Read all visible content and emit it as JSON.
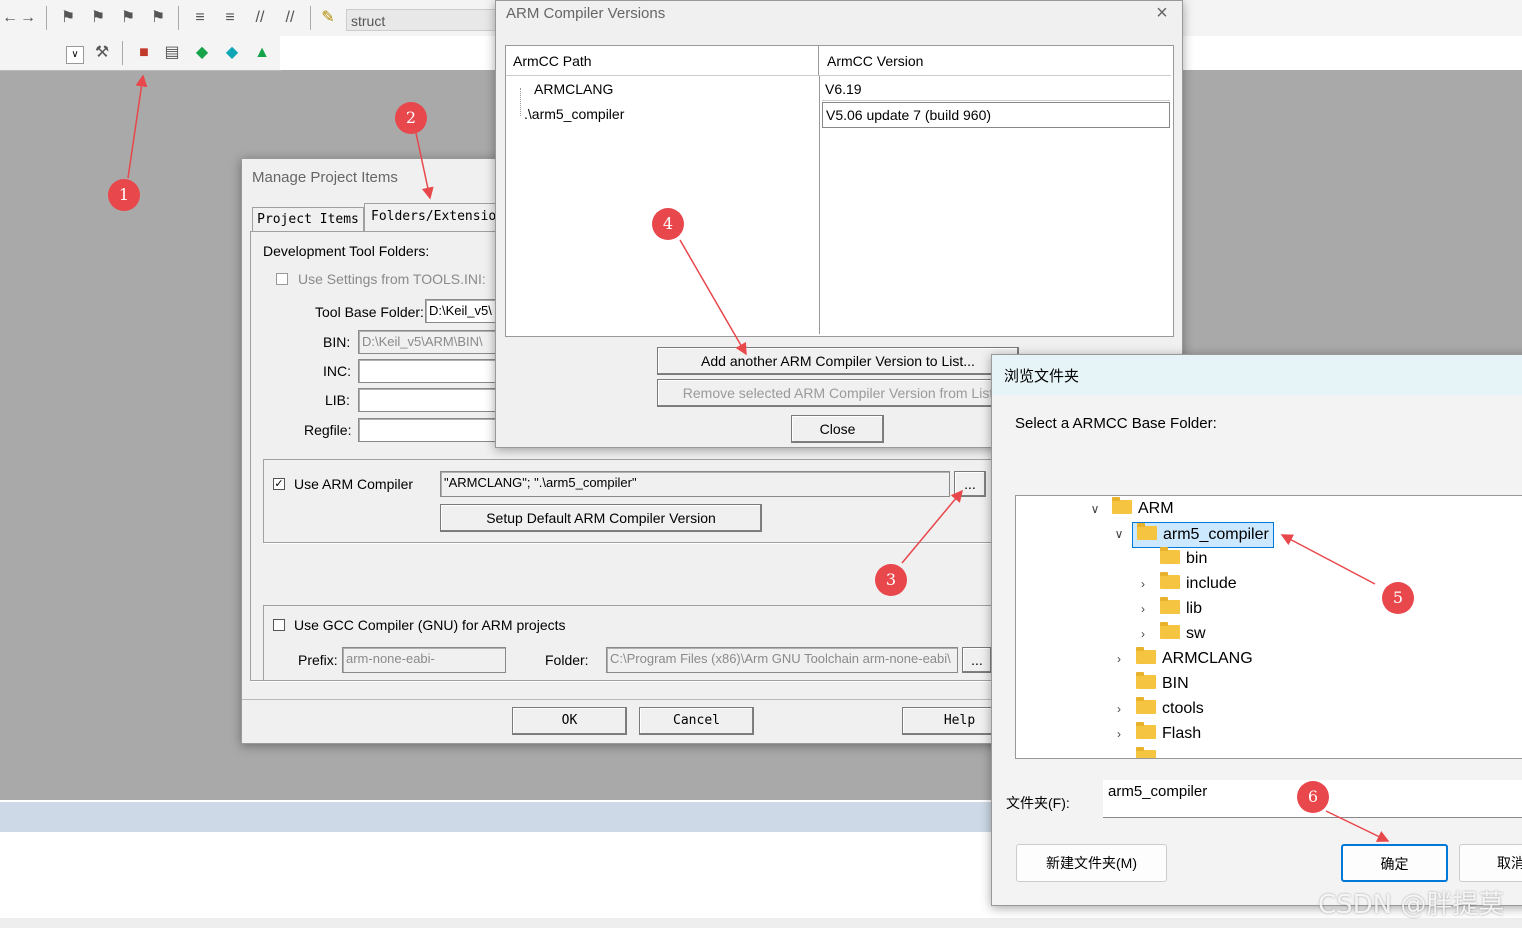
{
  "toolbar": {
    "search_text": "struct"
  },
  "manage_dialog": {
    "title": "Manage Project Items",
    "tabs": [
      "Project Items",
      "Folders/Extensions"
    ],
    "section_label": "Development Tool Folders:",
    "use_settings_label": "Use Settings from TOOLS.INI:",
    "tool_base_label": "Tool Base Folder:",
    "tool_base_value": "D:\\Keil_v5\\",
    "bin_label": "BIN:",
    "bin_value": "D:\\Keil_v5\\ARM\\BIN\\",
    "inc_label": "INC:",
    "lib_label": "LIB:",
    "regfile_label": "Regfile:",
    "use_arm_label": "Use ARM Compiler",
    "arm_compiler_value": "\"ARMCLANG\"; \".\\arm5_compiler\"",
    "browse_label": "...",
    "setup_default_label": "Setup Default ARM Compiler Version",
    "use_gcc_label": "Use GCC Compiler (GNU) for ARM projects",
    "prefix_label": "Prefix:",
    "prefix_value": "arm-none-eabi-",
    "folder_label": "Folder:",
    "folder_value": "C:\\Program Files (x86)\\Arm GNU Toolchain arm-none-eabi\\",
    "ok_label": "OK",
    "cancel_label": "Cancel",
    "help_label": "Help"
  },
  "arm_dialog": {
    "title": "ARM Compiler Versions",
    "col_path": "ArmCC Path",
    "col_version": "ArmCC Version",
    "rows": [
      {
        "path": "ARMCLANG",
        "version": "V6.19"
      },
      {
        "path": ".\\arm5_compiler",
        "version": "V5.06 update 7 (build 960)"
      }
    ],
    "add_label": "Add another ARM Compiler Version to List...",
    "remove_label": "Remove selected ARM Compiler Version from List",
    "close_label": "Close"
  },
  "browse_dialog": {
    "title": "浏览文件夹",
    "prompt": "Select a ARMCC Base Folder:",
    "tree": [
      {
        "label": "ARM",
        "level": 0,
        "chev": "v"
      },
      {
        "label": "arm5_compiler",
        "level": 1,
        "chev": "v",
        "selected": true
      },
      {
        "label": "bin",
        "level": 2,
        "chev": ""
      },
      {
        "label": "include",
        "level": 2,
        "chev": ">"
      },
      {
        "label": "lib",
        "level": 2,
        "chev": ">"
      },
      {
        "label": "sw",
        "level": 2,
        "chev": ">"
      },
      {
        "label": "ARMCLANG",
        "level": 1,
        "chev": ">"
      },
      {
        "label": "BIN",
        "level": 1,
        "chev": ""
      },
      {
        "label": "ctools",
        "level": 1,
        "chev": ">"
      },
      {
        "label": "Flash",
        "level": 1,
        "chev": ">"
      }
    ],
    "folder_label": "文件夹(F):",
    "folder_value": "arm5_compiler",
    "new_folder_label": "新建文件夹(M)",
    "ok_label": "确定",
    "cancel_label": "取消"
  },
  "markers": [
    "1",
    "2",
    "3",
    "4",
    "5",
    "6"
  ],
  "watermark": "CSDN @胖提莫",
  "colors": {
    "marker": "#e8474b",
    "selection_border": "#0078d7",
    "selection_bg": "#cce8ff",
    "folder": "#f5c542"
  }
}
